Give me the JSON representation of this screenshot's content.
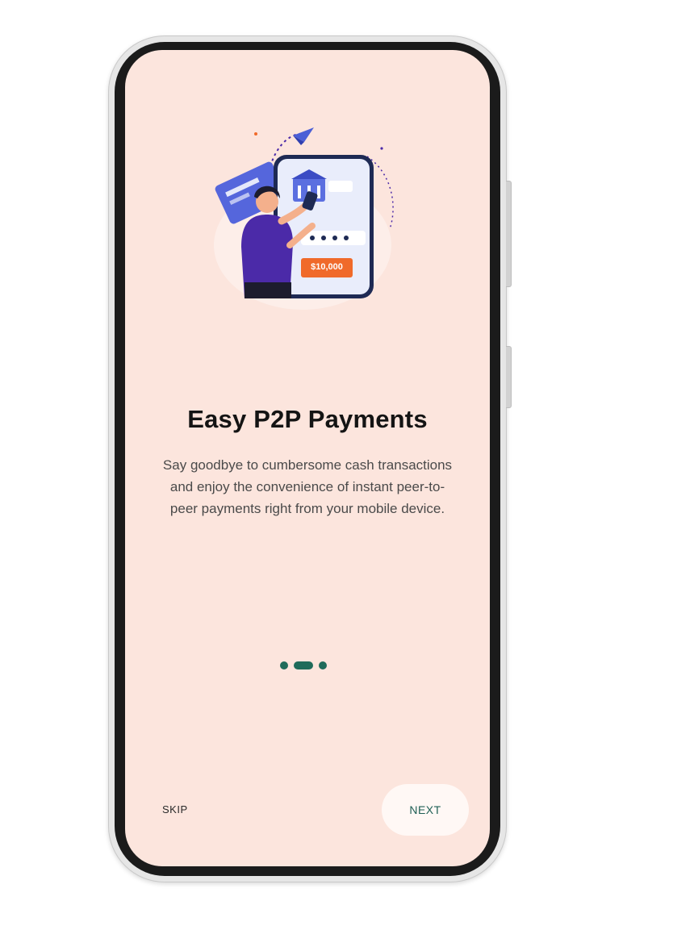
{
  "screen": {
    "title": "Easy P2P Payments",
    "description": "Say goodbye to cumbersome cash transactions and enjoy the convenience of instant peer-to-peer payments right from your mobile device.",
    "illustration": {
      "icon": "payment-illustration-icon",
      "amount_label": "$10,000",
      "accent_colors": [
        "#5b6fe0",
        "#4b2aa8",
        "#f06a2a"
      ]
    },
    "pagination": {
      "total": 3,
      "active_index": 1,
      "color": "#1f6b5a"
    },
    "skip_label": "SKIP",
    "next_label": "NEXT"
  },
  "colors": {
    "screen_background": "#fce5dd",
    "next_button_background": "#fff8f5",
    "phone_frame": "#1b1b1b"
  }
}
